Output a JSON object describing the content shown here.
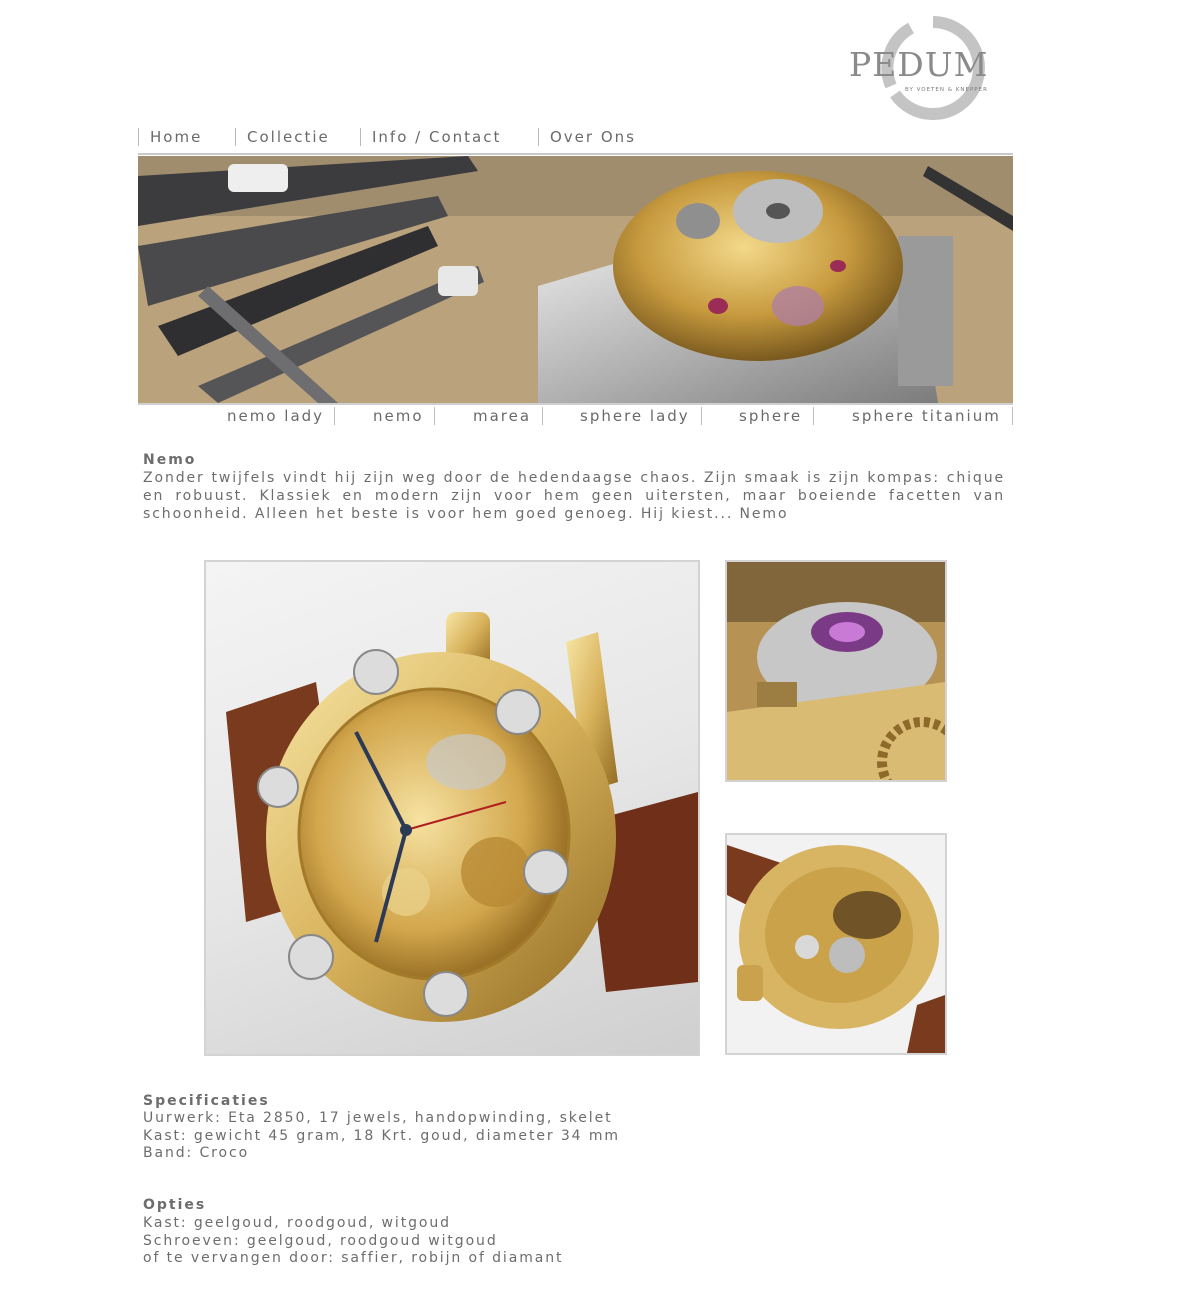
{
  "brand": {
    "logo_word": "PEDUM",
    "logo_tagline": "BY VOETEN & KNEPPER"
  },
  "topnav": {
    "items": [
      "Home",
      "Collectie",
      "Info / Contact",
      "Over Ons"
    ]
  },
  "subnav": {
    "items": [
      "nemo lady",
      "nemo",
      "marea",
      "sphere lady",
      "sphere",
      "sphere titanium"
    ]
  },
  "intro": {
    "title": "Nemo",
    "text": "Zonder twijfels vindt hij zijn weg door de hedendaagse chaos. Zijn smaak is zijn kompas: chique en robuust. Klassiek en modern zijn voor hem geen uitersten, maar boeiende facetten van schoonheid. Alleen het beste is voor hem goed genoeg. Hij kiest... Nemo"
  },
  "specs": {
    "title": "Specificaties",
    "lines": [
      "Uurwerk: Eta 2850, 17 jewels, handopwinding, skelet",
      "Kast: gewicht 45 gram, 18 Krt. goud, diameter 34 mm",
      "Band: Croco"
    ]
  },
  "options": {
    "title": "Opties",
    "lines": [
      "Kast: geelgoud, roodgoud, witgoud",
      "Schroeven: geelgoud, roodgoud witgoud",
      "of te vervangen door: saffier, robijn of diamant"
    ]
  }
}
